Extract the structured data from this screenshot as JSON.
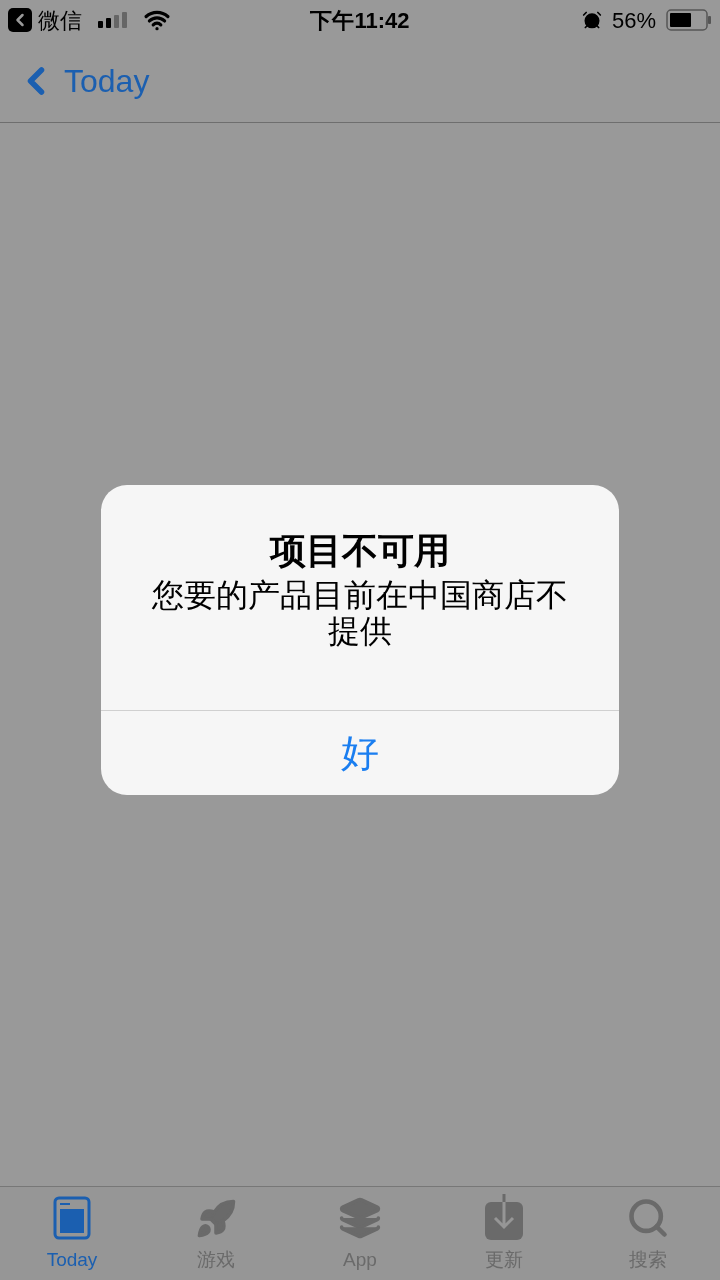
{
  "status_bar": {
    "back_app": "微信",
    "time": "下午11:42",
    "battery": "56%"
  },
  "nav_bar": {
    "back": "Today"
  },
  "alert": {
    "title": "项目不可用",
    "message": "您要的产品目前在中国商店不提供",
    "button": "好"
  },
  "tab_bar": [
    {
      "kind": "today",
      "label": "Today",
      "selected": true
    },
    {
      "kind": "games",
      "label": "游戏",
      "selected": false
    },
    {
      "kind": "apps",
      "label": "App",
      "selected": false
    },
    {
      "kind": "updates",
      "label": "更新",
      "selected": false
    },
    {
      "kind": "search",
      "label": "搜索",
      "selected": false
    }
  ]
}
